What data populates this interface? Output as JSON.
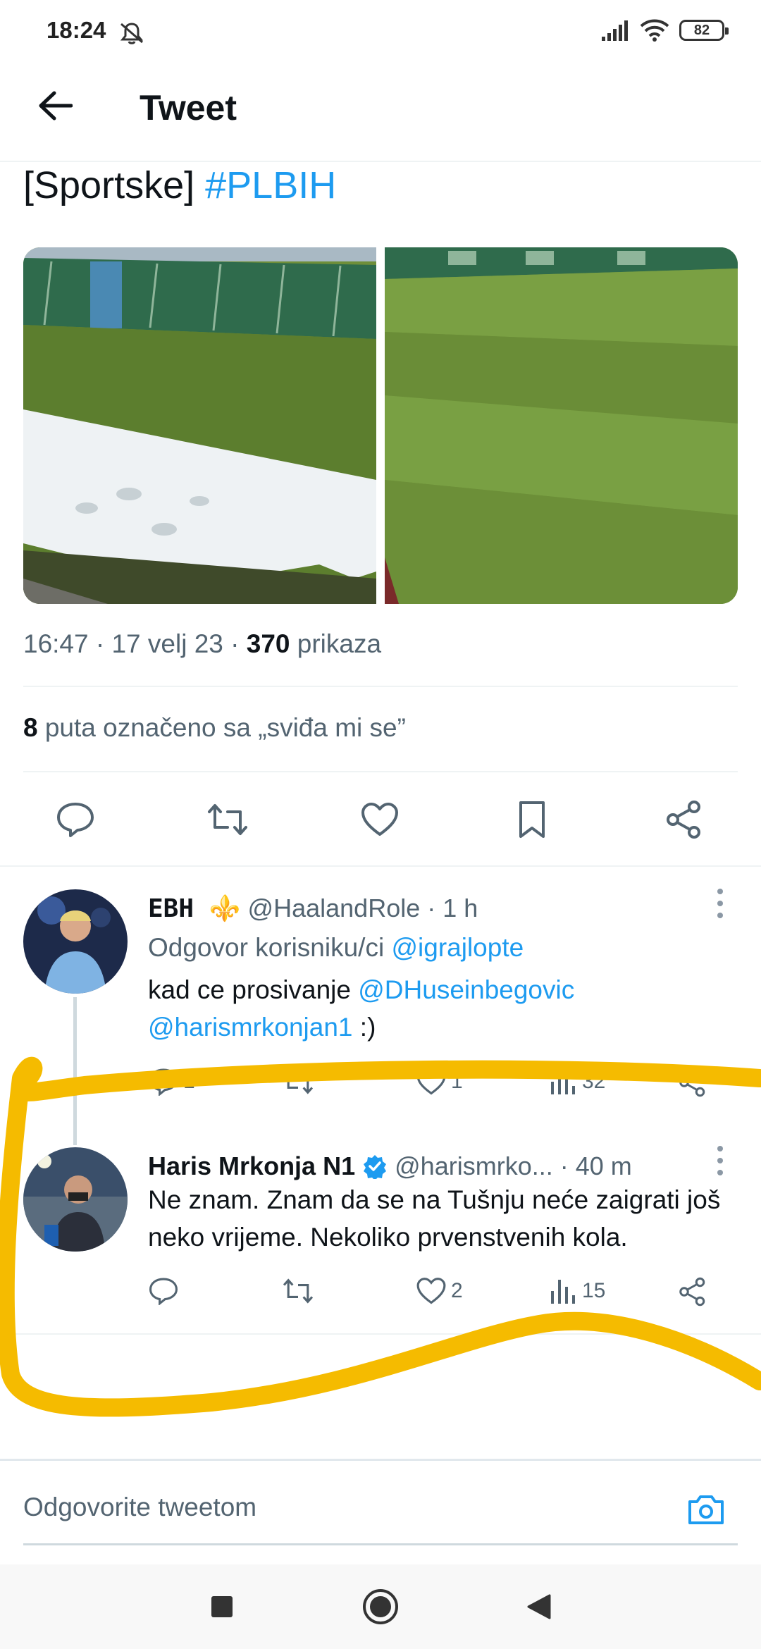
{
  "status_bar": {
    "time": "18:24",
    "battery": "82"
  },
  "header": {
    "title": "Tweet"
  },
  "tweet": {
    "text_prefix": "[Sportske] ",
    "hashtag": "#PLBIH",
    "meta_time": "16:47 · 17 velj 23 · ",
    "views_count": "370",
    "views_label": " prikaza",
    "likes_count": "8",
    "likes_label": " puta označeno sa „sviđa mi se”"
  },
  "replies": [
    {
      "display_name": "EBH ⚜️",
      "handle": "@HaalandRole",
      "time": "· 1 h",
      "replying_prefix": "Odgovor korisniku/ci ",
      "replying_to": "@igrajlopte",
      "text_1": "kad ce prosivanje ",
      "mention_1": "@DHuseinbegovic",
      "mention_2": "@harismrkonjan1",
      "text_2": " :)",
      "likes": "1",
      "retweets": "",
      "replies_count": "1",
      "views": "32"
    },
    {
      "display_name": "Haris Mrkonja N1",
      "handle": "@harismrko...",
      "time": "· 40 m",
      "text": "Ne znam. Znam da se na Tušnju neće zaigrati još neko vrijeme. Nekoliko prvenstvenih kola.",
      "likes": "2",
      "views": "15"
    }
  ],
  "compose": {
    "placeholder": "Odgovorite tweetom"
  },
  "colors": {
    "accent": "#1d9bf0",
    "highlight": "#f5bb00",
    "verified": "#1d9bf0"
  },
  "icons": {
    "reply": "reply-icon",
    "retweet": "retweet-icon",
    "like": "heart-icon",
    "bookmark": "bookmark-icon",
    "share": "share-icon",
    "views": "views-icon",
    "camera": "camera-icon",
    "back": "back-arrow-icon"
  }
}
